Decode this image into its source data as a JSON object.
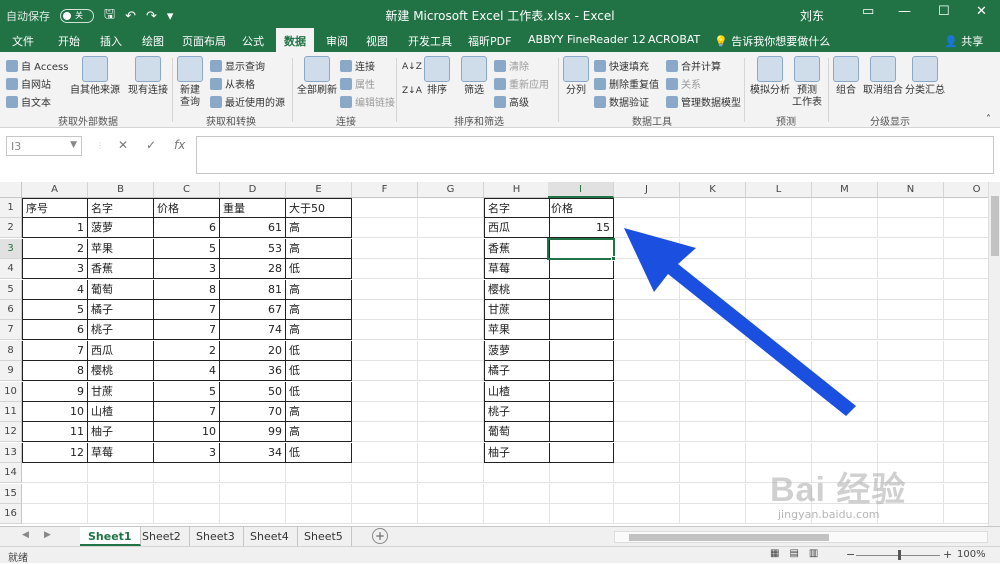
{
  "titlebar": {
    "autosave_label": "自动保存",
    "autosave_state": "关",
    "title": "新建 Microsoft Excel 工作表.xlsx  -  Excel",
    "user": "刘东"
  },
  "tabs": [
    "文件",
    "开始",
    "插入",
    "绘图",
    "页面布局",
    "公式",
    "数据",
    "审阅",
    "视图",
    "开发工具",
    "福昕PDF",
    "ABBYY FineReader 12",
    "ACROBAT"
  ],
  "active_tab": "数据",
  "tellme": "告诉我你想要做什么",
  "share": "共享",
  "ribbon": {
    "access": "自 Access",
    "web": "自网站",
    "text": "自文本",
    "other_sources": "自其他来源",
    "existing": "现有连接",
    "new_query": "新建\n查询",
    "show_queries": "显示查询",
    "from_table": "从表格",
    "recent_sources": "最近使用的源",
    "refresh_all": "全部刷新",
    "connections": "连接",
    "properties": "属性",
    "edit_links": "编辑链接",
    "sort": "排序",
    "filter": "筛选",
    "clear": "清除",
    "reapply": "重新应用",
    "advanced": "高级",
    "split": "分列",
    "flash_fill": "快速填充",
    "remove_dup": "删除重复值",
    "validation": "数据验证",
    "consolidate": "合并计算",
    "relationships": "关系",
    "manage_model": "管理数据模型",
    "what_if": "模拟分析",
    "forecast_sheet": "预测\n工作表",
    "group": "组合",
    "ungroup": "取消组合",
    "subtotal": "分类汇总",
    "groups": {
      "external": "获取外部数据",
      "transform": "获取和转换",
      "connections": "连接",
      "sort_filter": "排序和筛选",
      "data_tools": "数据工具",
      "forecast": "预测",
      "outline": "分级显示"
    }
  },
  "formula_bar": {
    "name_box": "I3",
    "cancel": "✕",
    "enter": "✓",
    "fx": "fx",
    "value": ""
  },
  "columns": [
    "A",
    "B",
    "C",
    "D",
    "E",
    "F",
    "G",
    "H",
    "I",
    "J",
    "K",
    "L",
    "M",
    "N",
    "O"
  ],
  "selected_column": "I",
  "rows": [
    "1",
    "2",
    "3",
    "4",
    "5",
    "6",
    "7",
    "8",
    "9",
    "10",
    "11",
    "12",
    "13",
    "14",
    "15",
    "16"
  ],
  "selected_row": "3",
  "table1": {
    "headers": [
      "序号",
      "名字",
      "价格",
      "重量",
      "大于50"
    ],
    "rows": [
      [
        "1",
        "菠萝",
        "6",
        "61",
        "高"
      ],
      [
        "2",
        "苹果",
        "5",
        "53",
        "高"
      ],
      [
        "3",
        "香蕉",
        "3",
        "28",
        "低"
      ],
      [
        "4",
        "葡萄",
        "8",
        "81",
        "高"
      ],
      [
        "5",
        "橘子",
        "7",
        "67",
        "高"
      ],
      [
        "6",
        "桃子",
        "7",
        "74",
        "高"
      ],
      [
        "7",
        "西瓜",
        "2",
        "20",
        "低"
      ],
      [
        "8",
        "樱桃",
        "4",
        "36",
        "低"
      ],
      [
        "9",
        "甘蔗",
        "5",
        "50",
        "低"
      ],
      [
        "10",
        "山楂",
        "7",
        "70",
        "高"
      ],
      [
        "11",
        "柚子",
        "10",
        "99",
        "高"
      ],
      [
        "12",
        "草莓",
        "3",
        "34",
        "低"
      ]
    ]
  },
  "table2": {
    "headers": [
      "名字",
      "价格"
    ],
    "rows": [
      [
        "西瓜",
        "15"
      ],
      [
        "香蕉",
        ""
      ],
      [
        "草莓",
        ""
      ],
      [
        "樱桃",
        ""
      ],
      [
        "甘蔗",
        ""
      ],
      [
        "苹果",
        ""
      ],
      [
        "菠萝",
        ""
      ],
      [
        "橘子",
        ""
      ],
      [
        "山楂",
        ""
      ],
      [
        "桃子",
        ""
      ],
      [
        "葡萄",
        ""
      ],
      [
        "柚子",
        ""
      ]
    ]
  },
  "sheets": [
    "Sheet1",
    "Sheet2",
    "Sheet3",
    "Sheet4",
    "Sheet5"
  ],
  "active_sheet": "Sheet1",
  "status": {
    "ready": "就绪",
    "zoom": "100%"
  },
  "watermark": {
    "brand": "Bai 经验",
    "url": "jingyan.baidu.com"
  },
  "colors": {
    "excel_green": "#217346",
    "arrow_blue": "#1a4fe0"
  }
}
